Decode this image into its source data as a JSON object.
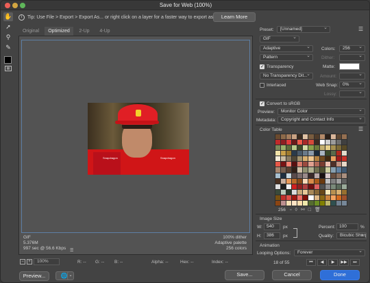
{
  "window": {
    "title": "Save for Web (100%)"
  },
  "tip": {
    "icon": "info-icon",
    "text": "Tip: Use File > Export > Export As... or right click on a layer for a faster way to export assets",
    "learn_more": "Learn More"
  },
  "tools": [
    "hand-icon",
    "slice-select-icon",
    "zoom-icon",
    "eyedropper-icon",
    "color-swatch",
    "toggle-slices-icon"
  ],
  "tabs": [
    {
      "label": "Original",
      "active": false
    },
    {
      "label": "Optimized",
      "active": true
    },
    {
      "label": "2-Up",
      "active": false
    },
    {
      "label": "4-Up",
      "active": false
    }
  ],
  "preview_info": {
    "format": "GIF",
    "size": "5.376M",
    "time": "997 sec @ 56.6 Kbps",
    "dither": "100% dither",
    "palette": "Adaptive palette",
    "colors": "256 colors"
  },
  "status": {
    "zoom": "100%",
    "r": "R: --",
    "g": "G: --",
    "b": "B: --",
    "alpha": "Alpha: --",
    "hex": "Hex: --",
    "index": "Index: --"
  },
  "panel": {
    "preset_label": "Preset:",
    "preset_value": "[Unnamed]",
    "format": "GIF",
    "reduction": "Adaptive",
    "colors_label": "Colors:",
    "colors_value": "256",
    "dither_algo": "Pattern",
    "dither_label": "Dither:",
    "transparency_label": "Transparency",
    "matte_label": "Matte:",
    "trans_dither": "No Transparency Dit...",
    "amount_label": "Amount:",
    "interlaced_label": "Interlaced",
    "websnap_label": "Web Snap:",
    "websnap_value": "0%",
    "lossy_label": "Lossy:",
    "convert_srgb_label": "Convert to sRGB",
    "preview_label": "Preview:",
    "preview_value": "Monitor Color",
    "metadata_label": "Metadata:",
    "metadata_value": "Copyright and Contact Info",
    "color_table_label": "Color Table",
    "color_count": "256",
    "image_size_label": "Image Size",
    "w_label": "W:",
    "w_value": "540",
    "h_label": "H:",
    "h_value": "386",
    "px": "px",
    "percent_label": "Percent:",
    "percent_value": "100",
    "percent_unit": "%",
    "quality_label": "Quality:",
    "quality_value": "Bicubic Sharper",
    "animation_label": "Animation",
    "looping_label": "Looping Options:",
    "looping_value": "Forever",
    "frame_counter": "18 of 55"
  },
  "buttons": {
    "preview": "Preview...",
    "save": "Save...",
    "cancel": "Cancel",
    "done": "Done"
  },
  "color_table_colors": [
    "#6b4a2e",
    "#8d6a4a",
    "#a47c5c",
    "#c9a283",
    "#3a2a1e",
    "#e0c2a4",
    "#7a5d3f",
    "#4f3b2a",
    "#b58b6a",
    "#2c2018",
    "#d9b69a",
    "#5e4733",
    "#946f51",
    "#c12a2a",
    "#8e1f22",
    "#e03b3b",
    "#6b1a1a",
    "#f05a4a",
    "#a82a2a",
    "#d44a3a",
    "#3d2a22",
    "#ffffff",
    "#cfcfcf",
    "#9c9c9c",
    "#6e6e6e",
    "#404040",
    "#7b8a5a",
    "#9ab06a",
    "#5c6b3a",
    "#b8c98a",
    "#3f4a28",
    "#d6dca8",
    "#8aa04a",
    "#6a7a3a",
    "#c4b070",
    "#e6d08a",
    "#a69050",
    "#7c6a38",
    "#584a26",
    "#f2e2a8",
    "#c9a04a",
    "#9e7a2e",
    "#2a3a4a",
    "#4a5a6a",
    "#6a7a8a",
    "#8a9aaa",
    "#1a2a3a",
    "#aab6c2",
    "#3a4a2a",
    "#5a6a4a",
    "#b22a1e",
    "#e2dccc",
    "#f5ecda",
    "#cabca2",
    "#8a7c62",
    "#514836",
    "#a3946f",
    "#d8b070",
    "#f0c890",
    "#b08040",
    "#704a20",
    "#402a12",
    "#e8a060",
    "#a01a1a",
    "#c83228",
    "#e85848",
    "#781414",
    "#f88070",
    "#581010",
    "#d87868",
    "#9c4a3e",
    "#e0a090",
    "#b06858",
    "#7a3c30",
    "#f0c0b0",
    "#503028",
    "#c09080",
    "#e8d8c8",
    "#a88870",
    "#786050",
    "#584030",
    "#302018",
    "#d0c0a8",
    "#909070",
    "#b0b090",
    "#707050",
    "#505030",
    "#d0d0a0",
    "#88a0b0",
    "#6080a0",
    "#405870",
    "#a8c0d0",
    "#203040",
    "#c8d8e0",
    "#5a4a4a",
    "#7a6a6a",
    "#9a8a8a",
    "#3a2a2a",
    "#baaaaa",
    "#1a1010",
    "#dacaca",
    "#6a5040",
    "#8a7060",
    "#aa9080",
    "#4a3020",
    "#cab0a0",
    "#ea9a5a",
    "#ba6a2a",
    "#8a4a1a",
    "#fadaba",
    "#da8a4a",
    "#aa5a1a",
    "#6a3a10",
    "#c0c0c0",
    "#808080",
    "#a0a0a0",
    "#606060",
    "#e0e0e0",
    "#202020",
    "#f0f0f0",
    "#d02020",
    "#902020",
    "#b04040",
    "#701010",
    "#e06060",
    "#505050",
    "#909090",
    "#7a8a7a",
    "#5a6a5a",
    "#9aaa9a",
    "#3a4a3a",
    "#bacaba",
    "#2a3a2a",
    "#dadada",
    "#c8a878",
    "#e8c898",
    "#a88858",
    "#886838",
    "#684818",
    "#f8e8b8",
    "#b89050",
    "#d8b070",
    "#987030",
    "#785010",
    "#c0302a",
    "#e05048",
    "#a01810",
    "#f07068",
    "#801008",
    "#ffffff",
    "#deb887",
    "#8b6914",
    "#cd853f",
    "#f4a460",
    "#d2691e",
    "#a0522d",
    "#8b4513",
    "#bc8f8f",
    "#f5deb3",
    "#ffe4c4",
    "#ffdead",
    "#eee8aa",
    "#556b2f",
    "#6b8e23",
    "#808000",
    "#bdb76b",
    "#2f4f4f",
    "#708090",
    "#778899",
    "#b0c4de",
    "#4682b4",
    "#5f9ea0",
    "#8fbc8f",
    "#2e8b57",
    "#3cb371",
    "#66cdaa",
    "#800000",
    "#a52a2a",
    "#b22222",
    "#dc143c",
    "#cd5c5c",
    "#f08080",
    "#e9967a",
    "#fa8072",
    "#ffa07a",
    "#ff7f50",
    "#ff6347",
    "#ff4500",
    "#8b0000",
    "#696969",
    "#a9a9a9",
    "#d3d3d3",
    "#dcdcdc",
    "#f5f5f5",
    "#000000",
    "#2b2b2b",
    "#4b4b4b",
    "#6b6b6b",
    "#8b8b8b",
    "#abab8b",
    "#cbcbab",
    "#7a5230",
    "#9a7250",
    "#ba9270",
    "#5a3210",
    "#da b290",
    "#3a1a00",
    "#fad2b0",
    "#e0c080",
    "#c0a060",
    "#a08040",
    "#806020",
    "#604000",
    "#f0e0a0",
    "#9c2a20",
    "#bc4a40",
    "#7c0a00",
    "#dc6a60",
    "#5c0000",
    "#fc8a80",
    "#403020",
    "#605040",
    "#807060",
    "#a09080",
    "#c0b0a0",
    "#e0d0c0",
    "#202818",
    "#404838",
    "#606858",
    "#808878",
    "#a0a898",
    "#c0c8b8",
    "#e0e8d8",
    "#182028",
    "#384048",
    "#586068",
    "#788088",
    "#98a0a8",
    "#b8c0c8",
    "#d8e0e8",
    "#281818",
    "#483838",
    "#685858",
    "#887878",
    "#a89898",
    "#c8b8b8"
  ]
}
